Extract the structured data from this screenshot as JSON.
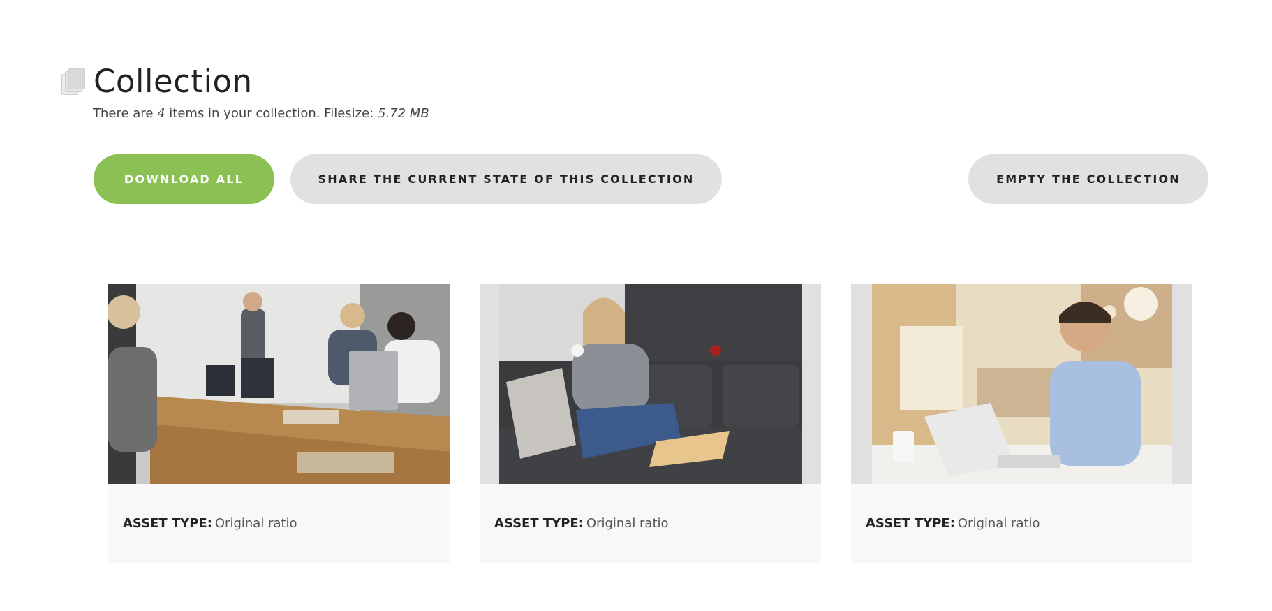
{
  "header": {
    "title": "Collection",
    "icon": "collection-stack-icon",
    "summary_prefix": "There are ",
    "item_count": "4",
    "summary_middle": " items in your collection. Filesize: ",
    "filesize": "5.72 MB"
  },
  "actions": {
    "download_all": "DOWNLOAD ALL",
    "share": "SHARE THE CURRENT STATE OF THIS COLLECTION",
    "empty": "EMPTY THE COLLECTION"
  },
  "colors": {
    "accent_green": "#8bc055",
    "button_gray": "#e1e1e1",
    "card_bg": "#f8f8f8"
  },
  "assets": [
    {
      "type_label": "ASSET TYPE:",
      "type_value": "Original ratio",
      "image": "team-meeting-office-photo"
    },
    {
      "type_label": "ASSET TYPE:",
      "type_value": "Original ratio",
      "image": "woman-sofa-laptop-photo"
    },
    {
      "type_label": "ASSET TYPE:",
      "type_value": "Original ratio",
      "image": "man-laptop-cafe-photo"
    }
  ]
}
